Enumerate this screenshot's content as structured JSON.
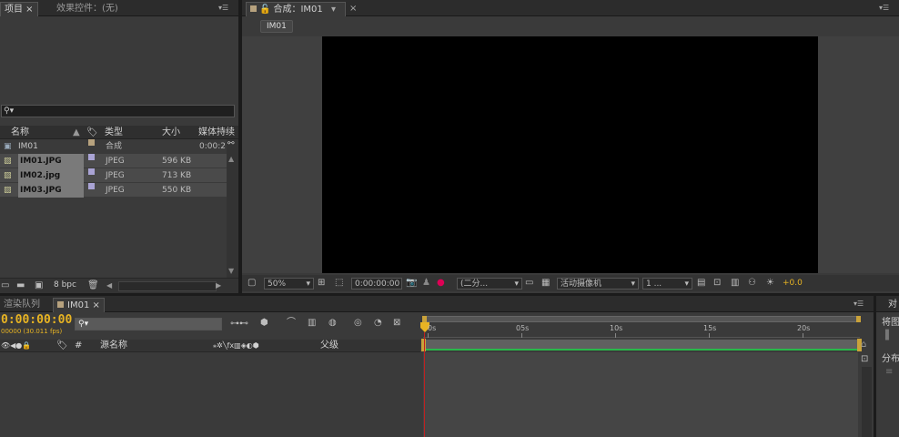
{
  "project_panel": {
    "tab_project": "项目",
    "tab_effects": "效果控件：(无)",
    "search_icon": "search-icon",
    "columns": {
      "name": "名称",
      "type": "类型",
      "size": "大小",
      "duration": "媒体持续"
    },
    "items": [
      {
        "name": "IM01",
        "type": "合成",
        "size": "",
        "duration": "0:00:2",
        "kind": "comp",
        "label_color": "#b7a27e"
      },
      {
        "name": "IM01.JPG",
        "type": "JPEG",
        "size": "596 KB",
        "duration": "",
        "kind": "image",
        "label_color": "#a9a3d4"
      },
      {
        "name": "IM02.jpg",
        "type": "JPEG",
        "size": "713 KB",
        "duration": "",
        "kind": "image",
        "label_color": "#a9a3d4"
      },
      {
        "name": "IM03.JPG",
        "type": "JPEG",
        "size": "550 KB",
        "duration": "",
        "kind": "image",
        "label_color": "#a9a3d4"
      }
    ],
    "bpc": "8 bpc"
  },
  "composition_panel": {
    "tab_title": "合成：IM01",
    "breadcrumb": "IM01",
    "zoom": "50%",
    "timecode": "0:00:00:00",
    "resolution": "(二分...",
    "camera": "活动摄像机",
    "views": "1 ...",
    "exposure": "+0.0"
  },
  "timeline_panel": {
    "tab_render": "渲染队列",
    "tab_comp": "IM01",
    "current_time": "0:00:00:00",
    "frame_info": "00000 (30.011 fps)",
    "col_hash": "#",
    "col_source": "源名称",
    "col_parent": "父级",
    "ruler": [
      "0s",
      "05s",
      "10s",
      "15s",
      "20s"
    ]
  },
  "right_panel": {
    "title": "对",
    "label_1": "将图",
    "label_2": "分布"
  },
  "colors": {
    "accent_time": "#e8b423",
    "work_bar": "#29b94a",
    "playhead": "#c02020"
  }
}
